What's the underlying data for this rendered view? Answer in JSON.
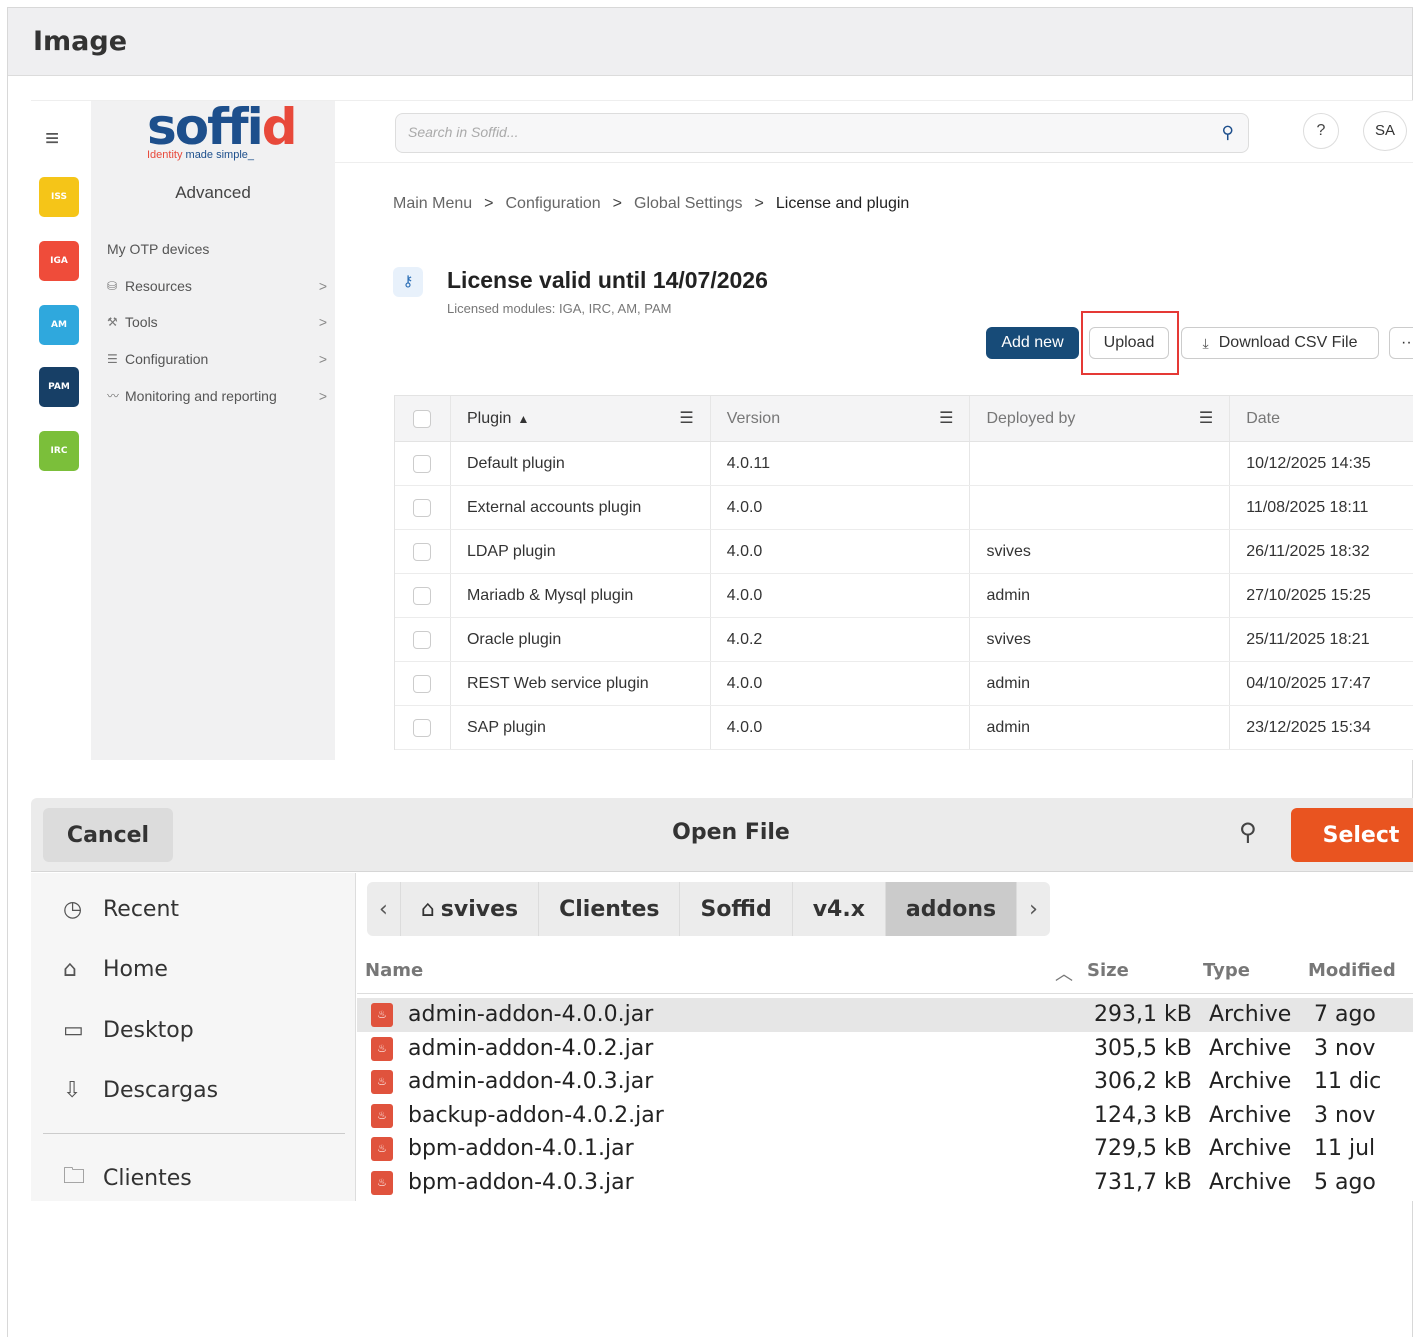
{
  "panel": {
    "title": "Image"
  },
  "soffid": {
    "logo": {
      "word_main": "soff",
      "word_i": "i",
      "word_d": "d",
      "tag_highlight": "Identity",
      "tag_rest": " made simple_"
    },
    "apps": [
      {
        "label": "ISS",
        "color": "#f5c518"
      },
      {
        "label": "IGA",
        "color": "#ef4c3a"
      },
      {
        "label": "AM",
        "color": "#2fa8dd"
      },
      {
        "label": "PAM",
        "color": "#173f66"
      },
      {
        "label": "IRC",
        "color": "#7bbf3a"
      }
    ],
    "sidebar": {
      "mode": "Advanced",
      "items": [
        {
          "label": "My OTP devices",
          "icon": "",
          "chevron": ""
        },
        {
          "label": "Resources",
          "icon": "database-icon",
          "chevron": ">"
        },
        {
          "label": "Tools",
          "icon": "wrench-icon",
          "chevron": ">"
        },
        {
          "label": "Configuration",
          "icon": "sliders-icon",
          "chevron": ">"
        },
        {
          "label": "Monitoring and reporting",
          "icon": "chart-icon",
          "chevron": ">"
        }
      ]
    },
    "search": {
      "placeholder": "Search in Soffid..."
    },
    "help": "?",
    "user": "SA",
    "breadcrumb": [
      "Main Menu",
      "Configuration",
      "Global Settings",
      "License and plugin"
    ],
    "license": {
      "title": "License valid until 14/07/2026",
      "modules": "Licensed modules: IGA, IRC, AM, PAM"
    },
    "actions": {
      "add_new": "Add new",
      "upload": "Upload",
      "download_csv": "Download CSV File",
      "more": "···"
    },
    "table": {
      "columns": [
        "Plugin",
        "Version",
        "Deployed by",
        "Date"
      ],
      "rows": [
        [
          "Default plugin",
          "4.0.11",
          "",
          "10/12/2025 14:35"
        ],
        [
          "External accounts plugin",
          "4.0.0",
          "",
          "11/08/2025 18:11"
        ],
        [
          "LDAP plugin",
          "4.0.0",
          "svives",
          "26/11/2025 18:32"
        ],
        [
          "Mariadb & Mysql plugin",
          "4.0.0",
          "admin",
          "27/10/2025 15:25"
        ],
        [
          "Oracle plugin",
          "4.0.2",
          "svives",
          "25/11/2025 18:21"
        ],
        [
          "REST Web service plugin",
          "4.0.0",
          "admin",
          "04/10/2025 17:47"
        ],
        [
          "SAP plugin",
          "4.0.0",
          "admin",
          "23/12/2025 15:34"
        ]
      ]
    }
  },
  "dialog": {
    "title": "Open File",
    "cancel": "Cancel",
    "select": "Select",
    "places": [
      {
        "label": "Recent",
        "icon": "clock-icon"
      },
      {
        "label": "Home",
        "icon": "home-icon"
      },
      {
        "label": "Desktop",
        "icon": "desktop-icon"
      },
      {
        "label": "Descargas",
        "icon": "download-icon"
      },
      {
        "label": "Clientes",
        "icon": "folder-icon"
      }
    ],
    "path": [
      "svives",
      "Clientes",
      "Soffid",
      "v4.x",
      "addons"
    ],
    "columns": {
      "name": "Name",
      "size": "Size",
      "type": "Type",
      "modified": "Modified"
    },
    "files": [
      {
        "name": "admin-addon-4.0.0.jar",
        "size": "293,1 kB",
        "type": "Archive",
        "modified": "7 ago"
      },
      {
        "name": "admin-addon-4.0.2.jar",
        "size": "305,5 kB",
        "type": "Archive",
        "modified": "3 nov"
      },
      {
        "name": "admin-addon-4.0.3.jar",
        "size": "306,2 kB",
        "type": "Archive",
        "modified": "11 dic"
      },
      {
        "name": "backup-addon-4.0.2.jar",
        "size": "124,3 kB",
        "type": "Archive",
        "modified": "3 nov"
      },
      {
        "name": "bpm-addon-4.0.1.jar",
        "size": "729,5 kB",
        "type": "Archive",
        "modified": "11 jul"
      },
      {
        "name": "bpm-addon-4.0.3.jar",
        "size": "731,7 kB",
        "type": "Archive",
        "modified": "5 ago"
      }
    ]
  }
}
